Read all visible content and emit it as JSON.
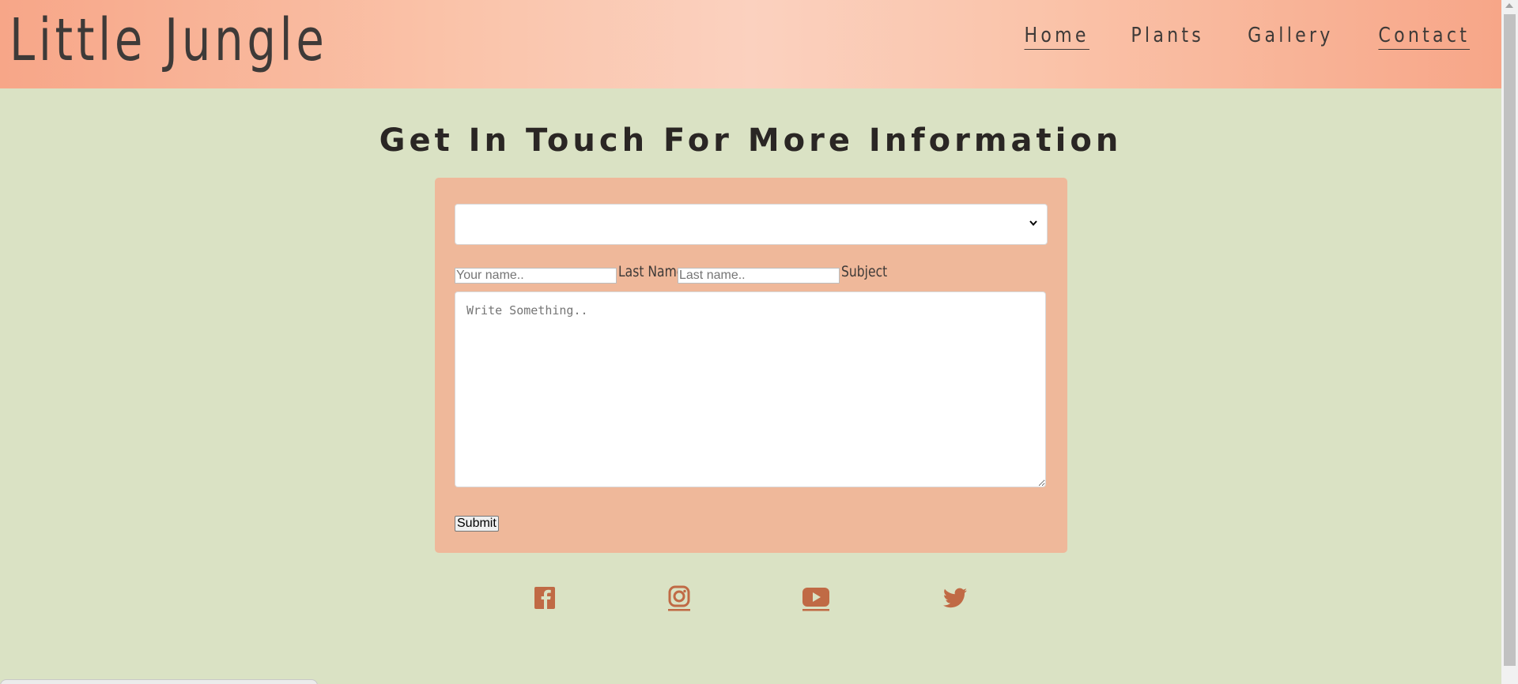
{
  "header": {
    "logo": "Little Jungle",
    "nav": [
      {
        "label": "Home",
        "underlined": true
      },
      {
        "label": "Plants",
        "underlined": false
      },
      {
        "label": "Gallery",
        "underlined": false
      },
      {
        "label": "Contact",
        "underlined": true
      }
    ]
  },
  "main": {
    "title": "Get In Touch For More Information"
  },
  "form": {
    "select_value": "",
    "first_name_placeholder": "Your name..",
    "last_name_label": "Last Name",
    "last_name_placeholder": "Last name..",
    "subject_label": "Subject",
    "message_placeholder": "Write Something..",
    "submit_label": "Submit"
  },
  "social": {
    "icons": [
      "facebook-icon",
      "instagram-icon",
      "youtube-icon",
      "twitter-icon"
    ],
    "color": "#c06a45"
  },
  "colors": {
    "background": "#dae2c4",
    "form_background": "#efb89a",
    "header_gradient_edge": "#f7a688",
    "header_gradient_center": "#fbd1bf",
    "text": "#3e3a38"
  }
}
